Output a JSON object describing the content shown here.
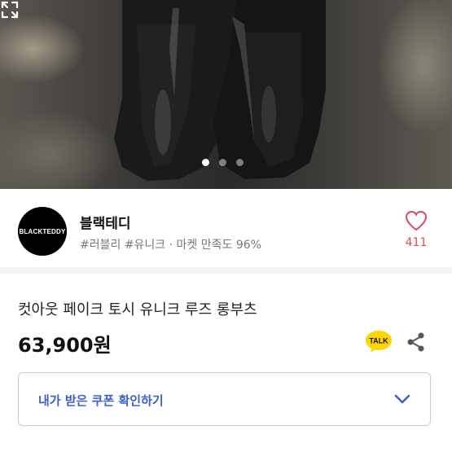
{
  "carousel": {
    "slide_count": 3,
    "active_index": 0
  },
  "store": {
    "logo_text": "BLACKTEDDY",
    "name": "블랙테디",
    "meta": "#러블리 #유니크 · 마켓 만족도 96%",
    "like_count": "411"
  },
  "product": {
    "title": "컷아웃 페이크 토시 유니크 루즈 롱부츠",
    "price": "63,900원",
    "talk_label": "TALK"
  },
  "coupon": {
    "label": "내가 받은 쿠폰 확인하기"
  },
  "colors": {
    "accent_blue": "#3c5fcf",
    "like_red": "#e2475a",
    "talk_yellow": "#ffd400"
  },
  "icons": [
    "expand-icon",
    "heart-icon",
    "kakao-talk-icon",
    "share-icon",
    "chevron-down-icon"
  ]
}
